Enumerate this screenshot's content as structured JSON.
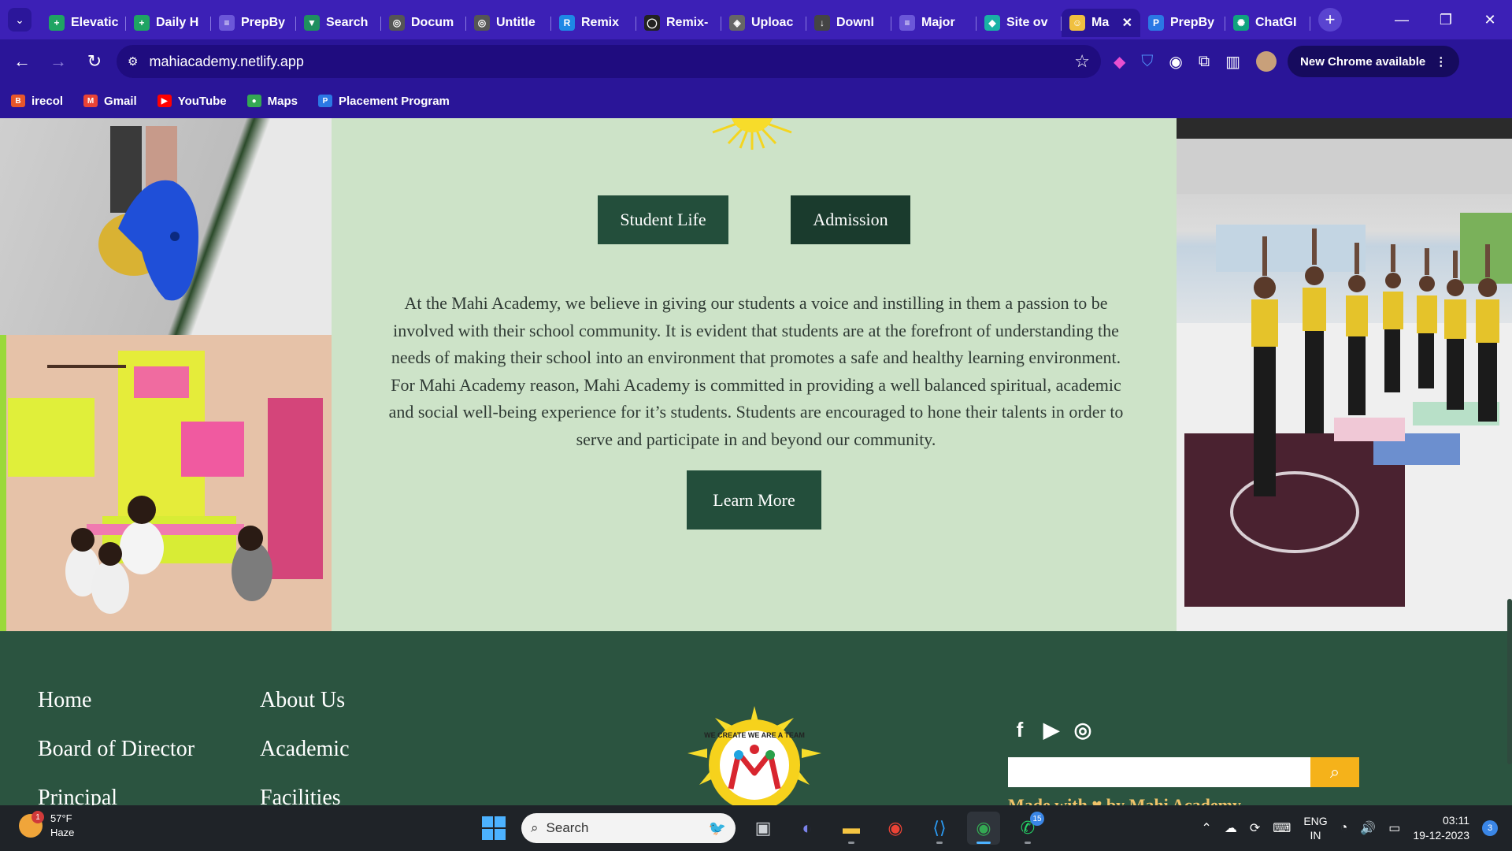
{
  "browser": {
    "tabs": [
      {
        "label": "Elevatic",
        "icon": "plus-icon",
        "color": "#1fa463"
      },
      {
        "label": "Daily H",
        "icon": "plus-icon",
        "color": "#1fa463"
      },
      {
        "label": "PrepBy",
        "icon": "list-icon",
        "color": "#6b57d8"
      },
      {
        "label": "Search",
        "icon": "vercel-icon",
        "color": "#1f8f5f"
      },
      {
        "label": "Docum",
        "icon": "globe-icon",
        "color": "#555"
      },
      {
        "label": "Untitle",
        "icon": "globe-icon",
        "color": "#555"
      },
      {
        "label": "Remix",
        "icon": "remix-icon",
        "color": "#1e88e5"
      },
      {
        "label": "Remix-",
        "icon": "github-icon",
        "color": "#222"
      },
      {
        "label": "Uploac",
        "icon": "layers-icon",
        "color": "#666"
      },
      {
        "label": "Downl",
        "icon": "download-icon",
        "color": "#444"
      },
      {
        "label": "Major",
        "icon": "list-icon",
        "color": "#6b57d8"
      },
      {
        "label": "Site ov",
        "icon": "diamond-icon",
        "color": "#19b1a5"
      },
      {
        "label": "Ma",
        "icon": "smile-icon",
        "color": "#f0c040",
        "active": true
      },
      {
        "label": "PrepBy",
        "icon": "pb-icon",
        "color": "#2b78e4"
      },
      {
        "label": "ChatGI",
        "icon": "chatgpt-icon",
        "color": "#10a37f"
      }
    ],
    "url": "mahiacademy.netlify.app",
    "update_label": "New Chrome available",
    "bookmarks": [
      {
        "label": "irecol",
        "icon": "irecol-icon",
        "color": "#e8562a"
      },
      {
        "label": "Gmail",
        "icon": "gmail-icon",
        "color": "#ea4335"
      },
      {
        "label": "YouTube",
        "icon": "youtube-icon",
        "color": "#ff0000"
      },
      {
        "label": "Maps",
        "icon": "maps-icon",
        "color": "#34a853"
      },
      {
        "label": "Placement Program",
        "icon": "pb-icon",
        "color": "#2b78e4"
      }
    ]
  },
  "page": {
    "buttons": {
      "student_life": "Student Life",
      "admission": "Admission",
      "learn_more": "Learn More"
    },
    "about_text": "At the Mahi Academy, we believe in giving our students a voice and instilling in them a passion to be involved with their school community. It is evident that students are at the forefront of understanding the needs of making their school into an environment that promotes a safe and healthy learning environment. For Mahi Academy reason, Mahi Academy is committed in providing a well balanced spiritual, academic and social well-being experience for it’s students. Students are encouraged to hone their talents in order to serve and participate in and beyond our community.",
    "footer": {
      "links_col1": [
        "Home",
        "Board of Director",
        "Principal"
      ],
      "links_col2": [
        "About Us",
        "Academic",
        "Facilities"
      ],
      "logo_text": "WE CREATE WE ARE A TEAM",
      "social": [
        "facebook-icon",
        "youtube-icon",
        "instagram-icon"
      ],
      "search_placeholder": "",
      "made_with": "Made with ♥ by Mahi Academy"
    },
    "colors": {
      "page_bg": "#cde3c8",
      "button_bg": "#234e3b",
      "footer_bg": "#2b5440",
      "search_button": "#f5b21a"
    }
  },
  "taskbar": {
    "weather_temp": "57°F",
    "weather_desc": "Haze",
    "weather_badge": "1",
    "search_label": "Search",
    "whatsapp_badge": "15",
    "lang_line1": "ENG",
    "lang_line2": "IN",
    "time": "03:11",
    "date": "19-12-2023",
    "notifications": "3"
  }
}
